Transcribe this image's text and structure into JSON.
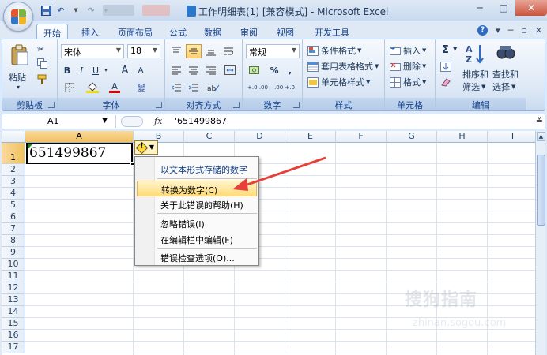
{
  "window": {
    "title": "工作明细表(1)  [兼容模式] - Microsoft Excel",
    "controls": {
      "minimize": "─",
      "maximize": "□",
      "close": "✕"
    }
  },
  "ribbon_tabs": [
    "开始",
    "插入",
    "页面布局",
    "公式",
    "数据",
    "审阅",
    "视图",
    "开发工具"
  ],
  "ribbon": {
    "clipboard": {
      "label": "剪贴板",
      "paste": "粘贴"
    },
    "font": {
      "label": "字体",
      "font_name": "宋体",
      "font_size": "18",
      "bold": "B",
      "italic": "I",
      "underline": "U",
      "grow": "A",
      "shrink": "A",
      "phonetic": "變"
    },
    "alignment": {
      "label": "对齐方式"
    },
    "number": {
      "label": "数字",
      "format": "常规",
      "percent": "%",
      "comma": ",",
      "inc_dec": "+.0 .00",
      "dec_dec": ".00 +.0"
    },
    "styles": {
      "label": "样式",
      "conditional": "条件格式",
      "as_table": "套用表格格式",
      "cell_styles": "单元格样式"
    },
    "cells": {
      "label": "单元格",
      "insert": "插入",
      "delete": "删除",
      "format": "格式"
    },
    "editing": {
      "label": "编辑",
      "sigma": "Σ",
      "sort": "排序和",
      "sort2": "筛选",
      "find": "查找和",
      "find2": "选择"
    }
  },
  "formula_bar": {
    "name_box": "A1",
    "fx": "fx",
    "content": "'651499867"
  },
  "columns": [
    "A",
    "B",
    "C",
    "D",
    "E",
    "F",
    "G",
    "H",
    "I"
  ],
  "rows": [
    "1",
    "2",
    "3",
    "4",
    "5",
    "6",
    "7",
    "8",
    "9",
    "10",
    "11",
    "12",
    "13",
    "14",
    "15",
    "16",
    "17"
  ],
  "cell_A1": "651499867",
  "error_menu": {
    "items": [
      {
        "label": "以文本形式存储的数字",
        "highlight": false
      },
      {
        "label": "转换为数字(C)",
        "highlight": true
      },
      {
        "label": "关于此错误的帮助(H)",
        "highlight": false
      },
      {
        "label": "忽略错误(I)",
        "highlight": false
      },
      {
        "label": "在编辑栏中编辑(F)",
        "highlight": false
      },
      {
        "label": "错误检查选项(O)...",
        "highlight": false
      }
    ]
  },
  "watermark": {
    "line1": "搜狗指南",
    "line2": "zhinan.sogou.com"
  },
  "colors": {
    "accent": "#e5413a",
    "ribbon": "#dde8f6",
    "highlight": "#ffdc7a"
  }
}
